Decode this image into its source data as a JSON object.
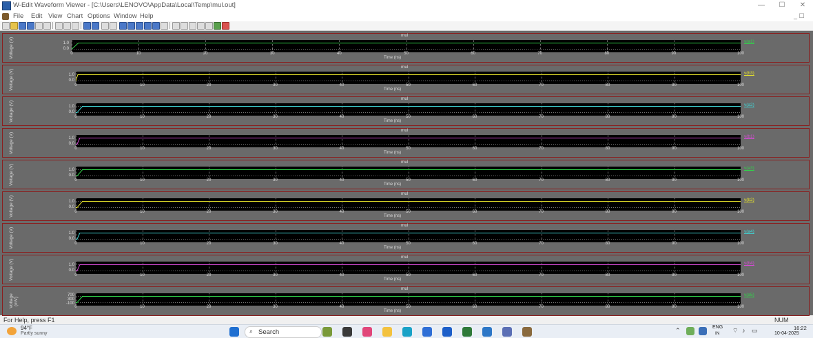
{
  "window": {
    "title": "W-Edit Waveform Viewer - [C:\\Users\\LENOVO\\AppData\\Local\\Temp\\mul.out]",
    "controls": [
      "—",
      "☐",
      "✕"
    ],
    "mdi_controls": "_ ☐"
  },
  "menu": [
    "File",
    "Edit",
    "View",
    "Chart",
    "Options",
    "Window",
    "Help"
  ],
  "charts": [
    {
      "title": "mul",
      "ylabel": "Voltage (V)",
      "yticks": [
        "1.0",
        "0.0"
      ],
      "xlabel": "Time (ns)",
      "xticks": [
        "0",
        "10",
        "20",
        "30",
        "40",
        "50",
        "60",
        "70",
        "80",
        "90",
        "100"
      ],
      "legend": "v(a1)",
      "color": "#31d34a",
      "rise_start": 0.0,
      "rise_end": 1.0
    },
    {
      "title": "mul",
      "ylabel": "Voltage (V)",
      "yticks": [
        "1.0",
        "0.0"
      ],
      "xlabel": "Time (ns)",
      "xticks": [
        "0",
        "10",
        "20",
        "30",
        "40",
        "50",
        "60",
        "70",
        "80",
        "90",
        "100"
      ],
      "legend": "v(b3)",
      "color": "#e6e22a",
      "rise_start": 0.0,
      "rise_end": 0.3
    },
    {
      "title": "mul",
      "ylabel": "Voltage (V)",
      "yticks": [
        "1.0",
        "0.0"
      ],
      "xlabel": "Time (ns)",
      "xticks": [
        "0",
        "10",
        "20",
        "30",
        "40",
        "50",
        "60",
        "70",
        "80",
        "90",
        "100"
      ],
      "legend": "v(a2)",
      "color": "#3fd4d4",
      "rise_start": 0.2,
      "rise_end": 1.0
    },
    {
      "title": "mul",
      "ylabel": "Voltage (V)",
      "yticks": [
        "1.0",
        "0.0"
      ],
      "xlabel": "Time (ns)",
      "xticks": [
        "0",
        "10",
        "20",
        "30",
        "40",
        "50",
        "60",
        "70",
        "80",
        "90",
        "100"
      ],
      "legend": "v(b1)",
      "color": "#d84ad8",
      "rise_start": 0.2,
      "rise_end": 0.6
    },
    {
      "title": "mul",
      "ylabel": "Voltage (V)",
      "yticks": [
        "1.0",
        "0.0"
      ],
      "xlabel": "Time (ns)",
      "xticks": [
        "0",
        "10",
        "20",
        "30",
        "40",
        "50",
        "60",
        "70",
        "80",
        "90",
        "100"
      ],
      "legend": "v(a3)",
      "color": "#31d34a",
      "rise_start": 0.2,
      "rise_end": 1.0
    },
    {
      "title": "mul",
      "ylabel": "Voltage (V)",
      "yticks": [
        "1.0",
        "0.0"
      ],
      "xlabel": "Time (ns)",
      "xticks": [
        "0",
        "10",
        "20",
        "30",
        "40",
        "50",
        "60",
        "70",
        "80",
        "90",
        "100"
      ],
      "legend": "v(b2)",
      "color": "#e6e22a",
      "rise_start": 0.2,
      "rise_end": 1.0
    },
    {
      "title": "mul",
      "ylabel": "Voltage (V)",
      "yticks": [
        "1.0",
        "0.0"
      ],
      "xlabel": "Time (ns)",
      "xticks": [
        "0",
        "10",
        "20",
        "30",
        "40",
        "50",
        "60",
        "70",
        "80",
        "90",
        "100"
      ],
      "legend": "v(a4)",
      "color": "#3fd4d4",
      "rise_start": 0.2,
      "rise_end": 0.6
    },
    {
      "title": "mul",
      "ylabel": "Voltage (V)",
      "yticks": [
        "1.0",
        "0.0"
      ],
      "xlabel": "Time (ns)",
      "xticks": [
        "0",
        "10",
        "20",
        "30",
        "40",
        "50",
        "60",
        "70",
        "80",
        "90",
        "100"
      ],
      "legend": "v(b4)",
      "color": "#d84ad8",
      "rise_start": 0.2,
      "rise_end": 0.6
    },
    {
      "title": "mul",
      "ylabel": "Voltage (mV)",
      "yticks": [
        "700",
        "300",
        "-100"
      ],
      "xlabel": "Time (ns)",
      "xticks": [
        "0",
        "10",
        "20",
        "30",
        "40",
        "50",
        "60",
        "70",
        "80",
        "90",
        "100"
      ],
      "legend": "v(a5)",
      "color": "#31d34a",
      "rise_start": 0.2,
      "rise_end": 1.0
    }
  ],
  "status": {
    "help": "For Help, press F1",
    "num": "NUM"
  },
  "taskbar": {
    "weather_temp": "94°F",
    "weather_desc": "Partly sunny",
    "search": "Search",
    "lang": "ENG",
    "region": "IN",
    "time": "16:22",
    "date": "10-04-2025"
  }
}
